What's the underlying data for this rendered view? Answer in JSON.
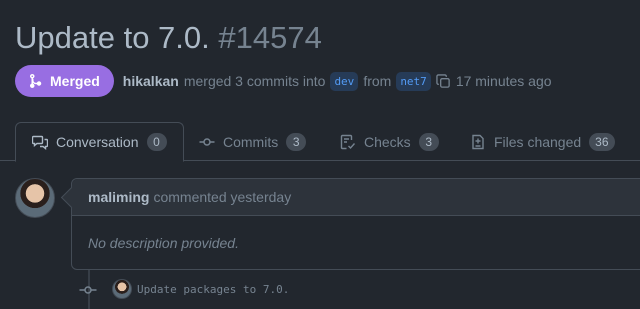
{
  "pr": {
    "title": "Update to 7.0.",
    "number": "#14574",
    "state_label": "Merged",
    "author": "hikalkan",
    "action_text": "merged 3 commits into",
    "base_branch": "dev",
    "from_text": "from",
    "head_branch": "net7",
    "time": "17 minutes ago"
  },
  "tabs": [
    {
      "label": "Conversation",
      "count": "0",
      "icon": "comment-discussion-icon"
    },
    {
      "label": "Commits",
      "count": "3",
      "icon": "git-commit-icon"
    },
    {
      "label": "Checks",
      "count": "3",
      "icon": "checklist-icon"
    },
    {
      "label": "Files changed",
      "count": "36",
      "icon": "file-diff-icon"
    }
  ],
  "comment": {
    "author": "maliming",
    "action": "commented yesterday",
    "body": "No description provided."
  },
  "commit": {
    "message": "Update packages to 7.0."
  },
  "colors": {
    "background": "#22272e",
    "merged_badge": "#986ee2",
    "branch_bg": "#263b57",
    "branch_text": "#539bf5"
  }
}
